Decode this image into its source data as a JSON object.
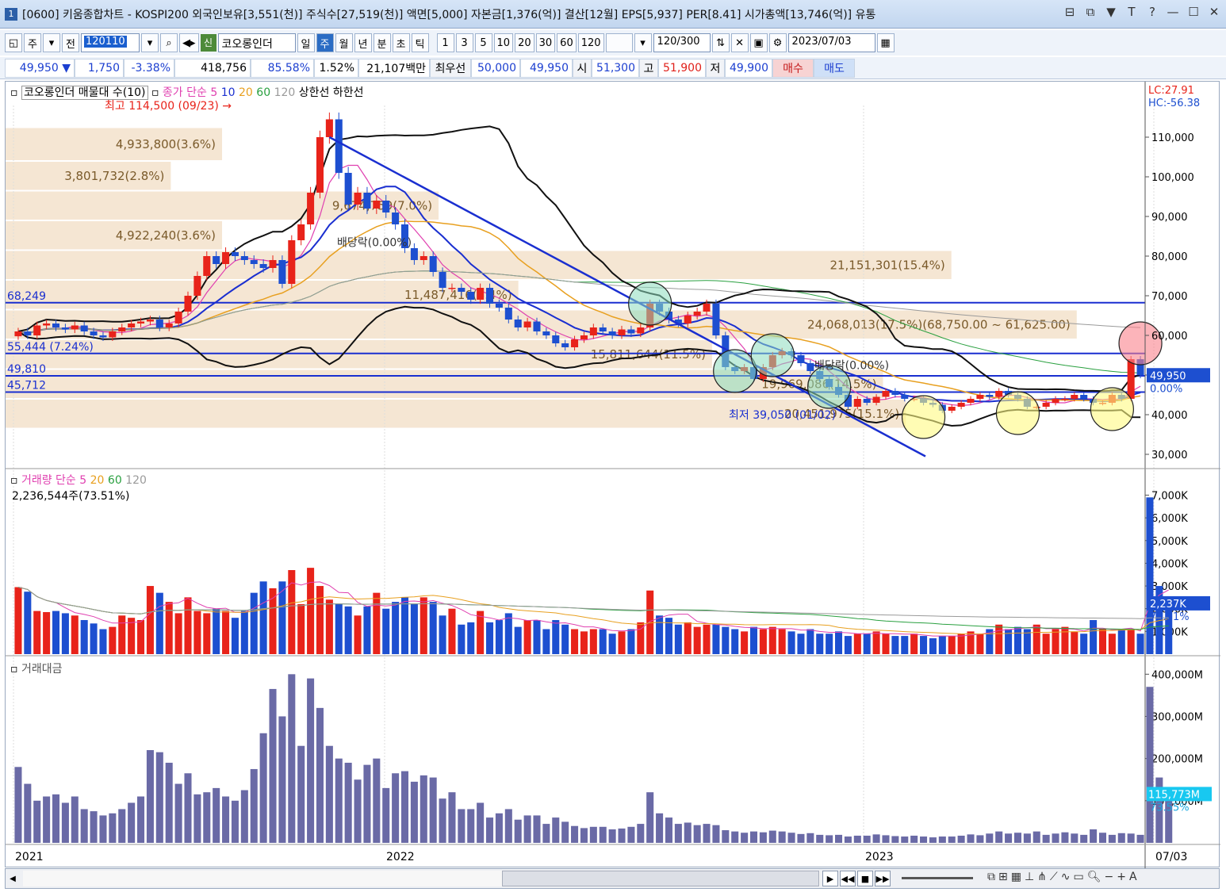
{
  "title": {
    "win_num": "1",
    "text": "[0600] 키움종합차트 - KOSPI200 외국인보유[3,551(천)] 주식수[27,519(천)] 액면[5,000] 자본금[1,376(억)] 결산[12월] EPS[5,937] PER[8.41] 시가총액[13,746(억)] 유통",
    "controls": [
      "⊟",
      "⧉",
      "▼",
      "T",
      "?",
      "—",
      "☐",
      "✕"
    ]
  },
  "toolbar": {
    "period_select": "주",
    "prev_label": "전",
    "code": "120110",
    "shin_label": "신",
    "stock_name": "코오롱인더",
    "period_tabs": [
      "일",
      "주",
      "월",
      "년",
      "분",
      "초",
      "틱"
    ],
    "active_tab": "주",
    "intervals": [
      "1",
      "3",
      "5",
      "10",
      "20",
      "30",
      "60",
      "120"
    ],
    "count": "120/300",
    "date": "2023/07/03"
  },
  "priceline": {
    "price": "49,950 ▼",
    "change": "1,750",
    "change_pct": "-3.38%",
    "volume": "418,756",
    "vol_ratio": "85.58%",
    "turnover": "1.52%",
    "amount": "21,107백만",
    "bid_label": "최우선",
    "ask1": "50,000",
    "bid1": "49,950",
    "open_label": "시",
    "open": "51,300",
    "high_label": "고",
    "high": "51,900",
    "low_label": "저",
    "low": "49,900",
    "buy_label": "매수",
    "sell_label": "매도"
  },
  "main_legend": {
    "stock": "코오롱인더 매물대 수(10)",
    "ma_label": "종가 단순",
    "ma_periods": [
      "5",
      "10",
      "20",
      "60",
      "120"
    ],
    "upper": "상한선",
    "lower": "하한선"
  },
  "vol_legend": {
    "title": "거래량",
    "ma_label": "단순",
    "periods": [
      "5",
      "20",
      "60",
      "120"
    ],
    "value": "2,236,544주(73.51%)"
  },
  "amt_legend": {
    "title": "거래대금"
  },
  "annotations": {
    "high_marker": "최고 114,500 (09/23) →",
    "low_marker": "최저 39,050 (01/02)",
    "div1": "배당락(0.00%)",
    "div2": "배당락(0.00%)",
    "top_right_lc": "LC:27.91",
    "top_right_hc": "HC:-56.38",
    "current_price_tag": "49,950",
    "current_pct_tag": "0.00%",
    "vol_tag": "2,237K",
    "vol_pct_tag": "73.51%",
    "amt_tag": "115,773M",
    "amt_pct_tag": "73.55%"
  },
  "volume_profile": [
    {
      "label": "4,933,800(3.6%)",
      "price_lo": 104000,
      "price_hi": 112500,
      "width_frac": 0.19
    },
    {
      "label": "3,801,732(2.8%)",
      "price_lo": 96500,
      "price_hi": 104000,
      "width_frac": 0.145
    },
    {
      "label": "9,674,759(7.0%)",
      "price_lo": 89000,
      "price_hi": 96500,
      "width_frac": 0.38
    },
    {
      "label": "4,922,240(3.6%)",
      "price_lo": 81500,
      "price_hi": 89000,
      "width_frac": 0.19
    },
    {
      "label": "21,151,301(15.4%)",
      "price_lo": 74000,
      "price_hi": 81500,
      "width_frac": 0.83
    },
    {
      "label": "11,487,416(8.4%)",
      "price_lo": 66500,
      "price_hi": 74000,
      "width_frac": 0.45
    },
    {
      "label": "24,068,013(17.5%)(68,750.00 ~ 61,625.00)",
      "price_lo": 59000,
      "price_hi": 66500,
      "width_frac": 0.94
    },
    {
      "label": "15,811,644(11.5%)",
      "price_lo": 51500,
      "price_hi": 59000,
      "width_frac": 0.62
    },
    {
      "label": "19,969,086(14.5%)",
      "price_lo": 44000,
      "price_hi": 51500,
      "width_frac": 0.77
    },
    {
      "label": "20,451,975(15.1%)",
      "price_lo": 36500,
      "price_hi": 44000,
      "width_frac": 0.79
    }
  ],
  "levels": [
    {
      "label": "68,249",
      "price": 68249
    },
    {
      "label": "55,444 (7.24%)",
      "price": 55444
    },
    {
      "label": "49,810",
      "price": 49810
    },
    {
      "label": "45,712",
      "price": 45712
    }
  ],
  "colors": {
    "up": "#e8231a",
    "down": "#1d4fd0",
    "ma5": "#e040b0",
    "ma10": "#1a2fd0",
    "ma20": "#e8a020",
    "ma60": "#2aa040",
    "ma120": "#9a9a9a",
    "band": "#111111",
    "trend": "#1a2fd0",
    "profile": "#f5e6d3",
    "amount_bar": "#6a6aa6",
    "tag_bg": "#1d4fd0"
  },
  "chart_data": [
    {
      "type": "candlestick",
      "title": "코오롱인더 주봉",
      "ylim": [
        28000,
        118000
      ],
      "y_ticks": [
        "110,000",
        "100,000",
        "90,000",
        "80,000",
        "70,000",
        "60,000",
        "50,000",
        "40,000",
        "30,000"
      ],
      "x_labels": [
        "2021",
        "2022",
        "2023",
        "07/03"
      ],
      "closes": [
        61000,
        60000,
        62500,
        63000,
        62000,
        61500,
        62500,
        61000,
        60000,
        59500,
        61000,
        62000,
        63000,
        63500,
        64000,
        62000,
        63000,
        66000,
        70000,
        75000,
        80000,
        78000,
        81000,
        80000,
        79000,
        78000,
        77000,
        79000,
        73000,
        84000,
        88000,
        96000,
        110000,
        114500,
        101000,
        93000,
        96000,
        92000,
        94000,
        91000,
        88000,
        82000,
        79000,
        80000,
        76000,
        72000,
        72000,
        71000,
        69000,
        72000,
        68000,
        67000,
        64000,
        62000,
        63500,
        61000,
        60000,
        58000,
        57000,
        59000,
        60000,
        62000,
        61000,
        60000,
        61500,
        60500,
        62000,
        68000,
        66000,
        64000,
        63000,
        65000,
        66000,
        68000,
        60000,
        52000,
        51000,
        52000,
        49000,
        52000,
        55000,
        56000,
        55000,
        53000,
        51000,
        49000,
        47000,
        45000,
        42000,
        44000,
        43000,
        44500,
        46000,
        45000,
        44000,
        44000,
        43000,
        42500,
        41000,
        42000,
        43000,
        44000,
        45000,
        44500,
        46000,
        45000,
        44000,
        42000,
        42000,
        43000,
        44000,
        44000,
        45000,
        44000,
        43000,
        43000,
        45000,
        44000,
        54000,
        49950
      ]
    },
    {
      "type": "bar",
      "title": "거래량",
      "ylim": [
        0,
        7400
      ],
      "y_ticks": [
        "7,000K",
        "6,000K",
        "5,000K",
        "4,000K",
        "3,000K",
        "2,000K",
        "1,000K"
      ],
      "unit": "K",
      "values": [
        2950,
        2750,
        1900,
        1850,
        1900,
        1800,
        1700,
        1500,
        1350,
        1100,
        1200,
        1700,
        1600,
        1500,
        3000,
        2700,
        2300,
        1800,
        2500,
        1900,
        1800,
        2000,
        1900,
        1600,
        1900,
        2700,
        3200,
        2900,
        3200,
        3700,
        2200,
        3800,
        3000,
        2400,
        2200,
        2100,
        1700,
        2100,
        2700,
        2000,
        2300,
        2500,
        2200,
        2500,
        2300,
        1700,
        2000,
        1300,
        1400,
        1900,
        1400,
        1500,
        1800,
        1200,
        1500,
        1500,
        1100,
        1500,
        1300,
        1100,
        1000,
        1100,
        1100,
        900,
        1000,
        1100,
        1400,
        2800,
        1700,
        1600,
        1300,
        1400,
        1200,
        1300,
        1300,
        1200,
        1100,
        1000,
        1200,
        1100,
        1200,
        1100,
        1000,
        900,
        1100,
        900,
        900,
        1000,
        800,
        900,
        900,
        1000,
        900,
        800,
        800,
        900,
        800,
        700,
        800,
        800,
        900,
        1000,
        900,
        1100,
        1300,
        1100,
        1200,
        1100,
        1300,
        900,
        1100,
        1200,
        1000,
        900,
        1500,
        1100,
        900,
        1100,
        1100,
        900,
        6900,
        3000,
        2237
      ]
    },
    {
      "type": "bar",
      "title": "거래대금",
      "ylim": [
        0,
        410000
      ],
      "y_ticks": [
        "400,000M",
        "300,000M",
        "200,000M",
        "100,000M"
      ],
      "unit": "M",
      "values": [
        180000,
        140000,
        100000,
        110000,
        115000,
        95000,
        110000,
        80000,
        75000,
        65000,
        70000,
        80000,
        95000,
        110000,
        220000,
        215000,
        190000,
        140000,
        165000,
        115000,
        120000,
        130000,
        110000,
        100000,
        125000,
        175000,
        260000,
        365000,
        300000,
        400000,
        230000,
        390000,
        320000,
        230000,
        200000,
        190000,
        150000,
        185000,
        200000,
        130000,
        165000,
        170000,
        145000,
        160000,
        155000,
        105000,
        120000,
        80000,
        80000,
        95000,
        60000,
        70000,
        80000,
        55000,
        65000,
        65000,
        45000,
        60000,
        50000,
        40000,
        35000,
        38000,
        38000,
        32000,
        34000,
        38000,
        45000,
        120000,
        70000,
        60000,
        45000,
        48000,
        42000,
        45000,
        42000,
        30000,
        27000,
        24000,
        27000,
        25000,
        29000,
        27000,
        24000,
        21000,
        23000,
        19000,
        18000,
        19000,
        15000,
        17000,
        17000,
        20000,
        18000,
        16000,
        15000,
        17000,
        15000,
        13000,
        15000,
        15000,
        17000,
        20000,
        18000,
        22000,
        27000,
        22000,
        24000,
        22000,
        27000,
        19000,
        22000,
        25000,
        22000,
        19000,
        32000,
        24000,
        19000,
        23000,
        22000,
        19000,
        370000,
        155000,
        115773
      ]
    }
  ]
}
